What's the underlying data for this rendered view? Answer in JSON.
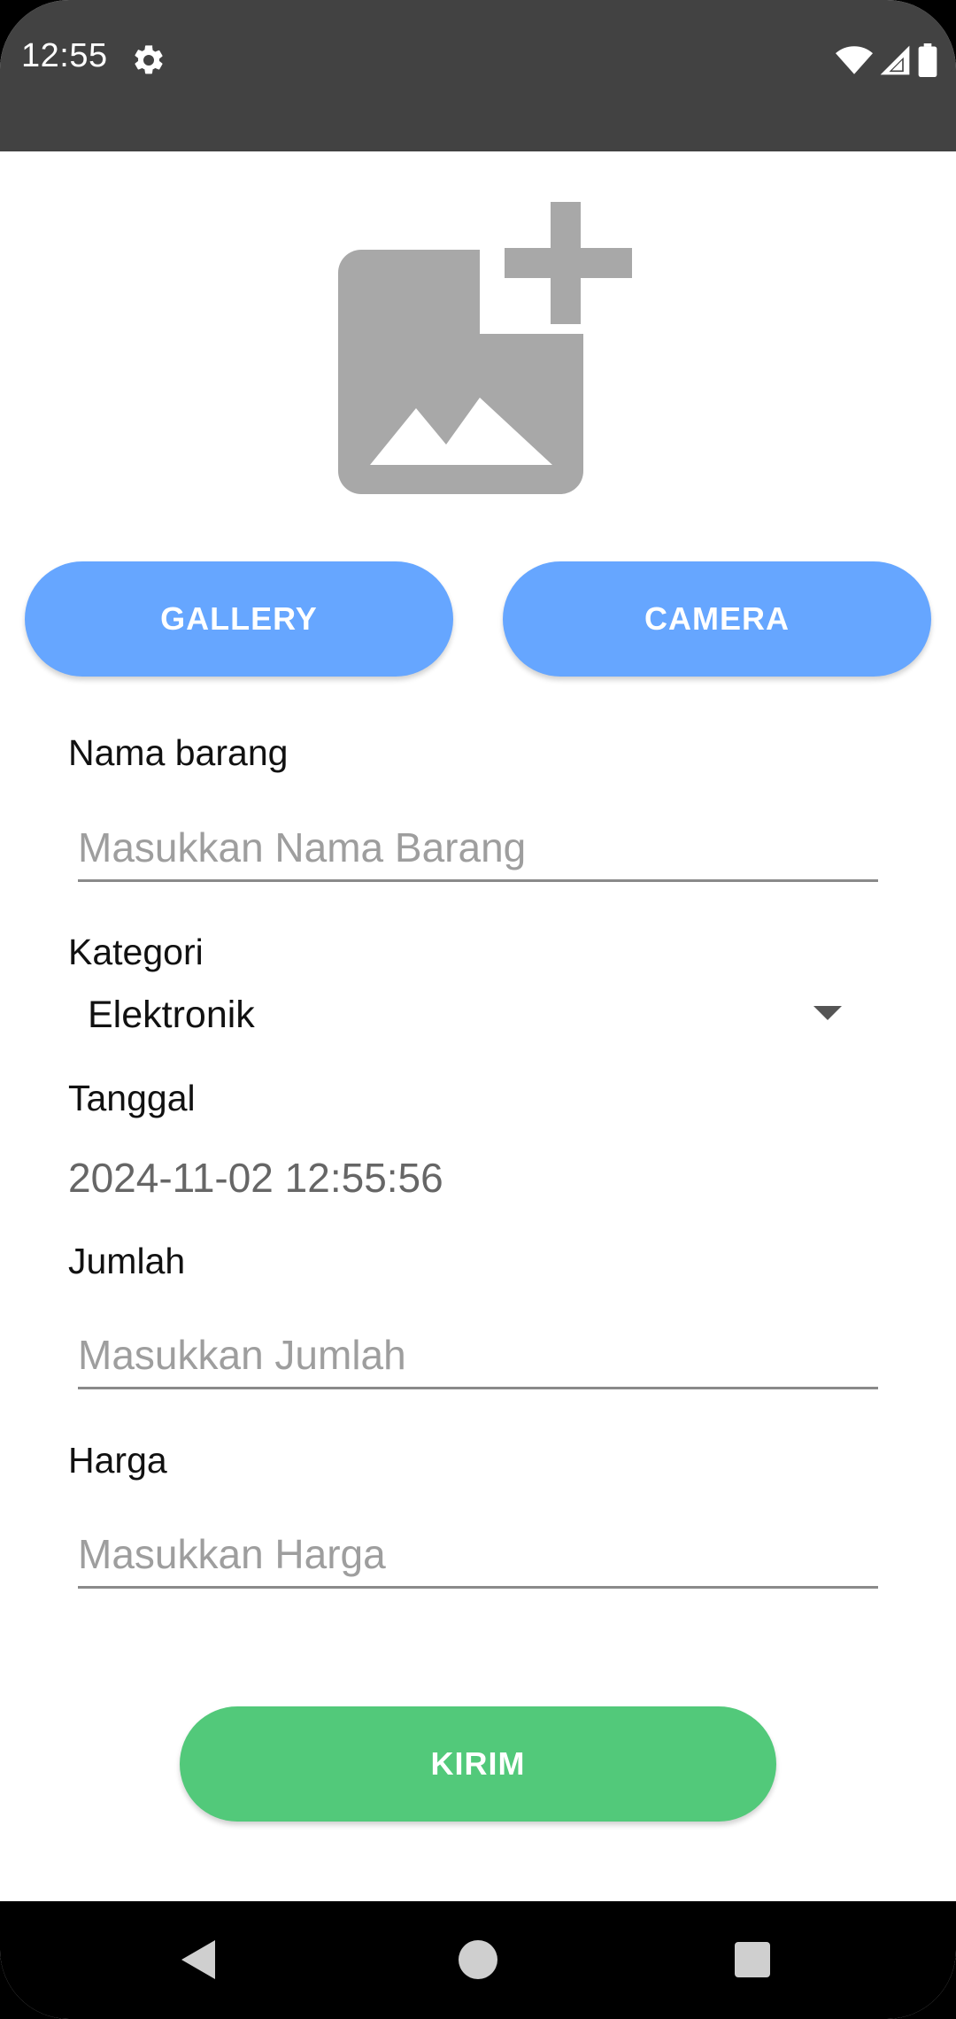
{
  "status_bar": {
    "time": "12:55",
    "icons": [
      "gear-icon",
      "wifi-icon",
      "signal-icon",
      "battery-icon"
    ]
  },
  "image_picker": {
    "icon": "add-photo-icon"
  },
  "buttons": {
    "gallery": "GALLERY",
    "camera": "CAMERA",
    "submit": "KIRIM"
  },
  "form": {
    "nama_barang": {
      "label": "Nama barang",
      "placeholder": "Masukkan Nama Barang",
      "value": ""
    },
    "kategori": {
      "label": "Kategori",
      "selected": "Elektronik"
    },
    "tanggal": {
      "label": "Tanggal",
      "value": "2024-11-02 12:55:56"
    },
    "jumlah": {
      "label": "Jumlah",
      "placeholder": "Masukkan Jumlah",
      "value": ""
    },
    "harga": {
      "label": "Harga",
      "placeholder": "Masukkan Harga",
      "value": ""
    }
  },
  "colors": {
    "status_bar": "#424242",
    "primary_button": "#66a6ff",
    "submit_button": "#52c97a",
    "placeholder_icon": "#a8a8a8"
  },
  "nav_bar": {
    "icons": [
      "back-icon",
      "home-icon",
      "recents-icon"
    ]
  }
}
